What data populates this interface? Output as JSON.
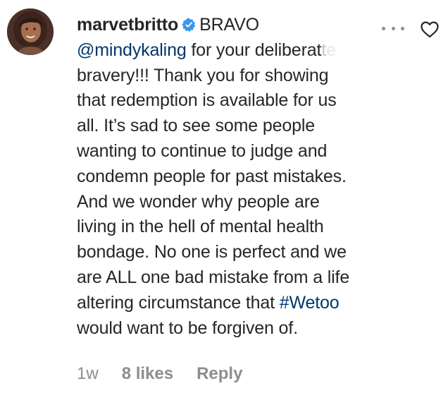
{
  "comment": {
    "username": "marvetbritto",
    "verified": true,
    "lines": {
      "l1_rest": "BRAVO",
      "l2_mention": "@mindykaling",
      "l2_text": " for your deliberat",
      "l2_fade1": "t",
      "l2_fade2": "e",
      "l3": "bravery!!! Thank you for showing",
      "l4": "that redemption is available for us",
      "l5": "all. It’s sad to see some people",
      "l6": "wanting to continue to judge and",
      "l7": "condemn people for past mistakes.",
      "l8": "And we wonder why people are",
      "l9": "living in the hell of mental health",
      "l10": "bondage. No one is perfect and we",
      "l11": "are ALL one bad mistake from a life",
      "l12_text": "altering circumstance that ",
      "l12_hashtag": "#Wetoo",
      "l13": "would want to be forgiven of."
    }
  },
  "meta": {
    "time": "1w",
    "likes": "8 likes",
    "reply": "Reply"
  },
  "icons": {
    "more": "more-options-icon",
    "heart": "heart-outline-icon",
    "verified": "verified-badge-icon"
  },
  "colors": {
    "link": "#00376b",
    "muted": "#8e8e8e",
    "verified": "#3897f0"
  }
}
